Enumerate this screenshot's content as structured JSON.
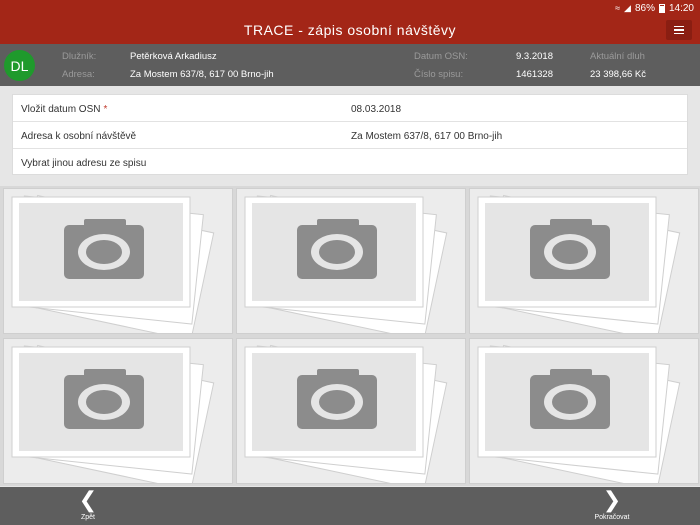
{
  "status": {
    "signal": "86%",
    "time": "14:20"
  },
  "app": {
    "title": "TRACE - zápis osobní návštěvy"
  },
  "header": {
    "avatar": "DL",
    "debtor_label": "Dlužník:",
    "debtor": "Petěrková Arkadiusz",
    "address_label": "Adresa:",
    "address": "Za Mostem 637/8, 617 00 Brno-jih",
    "osn_date_label": "Datum OSN:",
    "osn_date": "9.3.2018",
    "file_label": "Číslo spisu:",
    "file_number": "1461328",
    "debt_label": "Aktuální dluh",
    "debt": "23 398,66 Kč"
  },
  "form": {
    "osn_date_label": "Vložit datum OSN",
    "osn_date_required": "*",
    "osn_date_value": "08.03.2018",
    "visit_address_label": "Adresa k osobní návštěvě",
    "visit_address_value": "Za Mostem 637/8, 617 00 Brno-jih",
    "other_address_label": "Vybrat jinou adresu ze spisu"
  },
  "photos": [
    "camera-icon",
    "camera-icon",
    "camera-icon",
    "camera-icon",
    "camera-icon",
    "camera-icon"
  ],
  "nav": {
    "back": "Zpět",
    "next": "Pokračovat"
  }
}
